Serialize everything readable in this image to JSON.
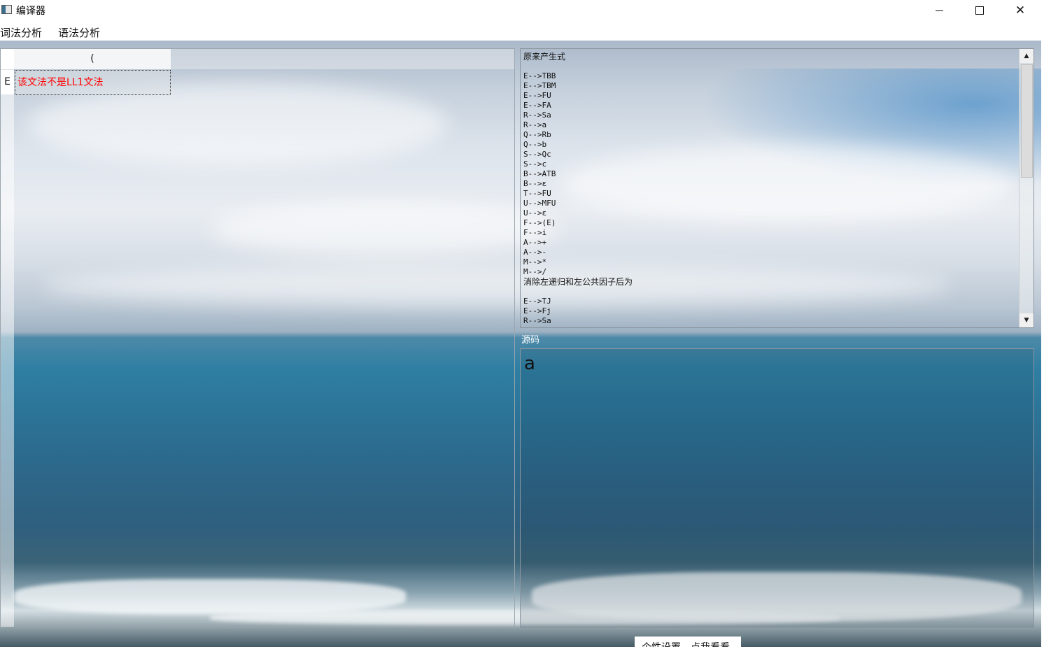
{
  "window": {
    "title": "编译器",
    "icons": {
      "app": "app-window-icon",
      "minimize": "minimize-icon",
      "maximize": "maximize-icon",
      "close": "close-icon"
    },
    "close_glyph": "✕"
  },
  "menu": {
    "items": [
      {
        "label": "词法分析"
      },
      {
        "label": "语法分析"
      }
    ]
  },
  "table": {
    "column_header": "(",
    "row_header": "E",
    "cell_value": "该文法不是LL1文法",
    "cell_color": "#ff0000"
  },
  "productions": {
    "heading1": "原来产生式",
    "original": [
      "E-->TBB",
      "E-->TBM",
      "E-->FU",
      "E-->FA",
      "R-->Sa",
      "R-->a",
      "Q-->Rb",
      "Q-->b",
      "S-->Qc",
      "S-->c",
      "B-->ATB",
      "B-->ε",
      "T-->FU",
      "U-->MFU",
      "U-->ε",
      "F-->(E)",
      "F-->i",
      "A-->+",
      "A-->-",
      "M-->*",
      "M-->/"
    ],
    "heading2": "消除左递归和左公共因子后为",
    "transformed": [
      "E-->TJ",
      "E-->Fj",
      "R-->Sa"
    ],
    "scroll_up_glyph": "▲",
    "scroll_down_glyph": "▼"
  },
  "source": {
    "label": "源码",
    "content": "a"
  },
  "bottom_button": {
    "label": "个性设置，点我看看"
  },
  "colors": {
    "error_text": "#ff0000",
    "sea": "#2b7397",
    "sky": "#e9edf2"
  }
}
